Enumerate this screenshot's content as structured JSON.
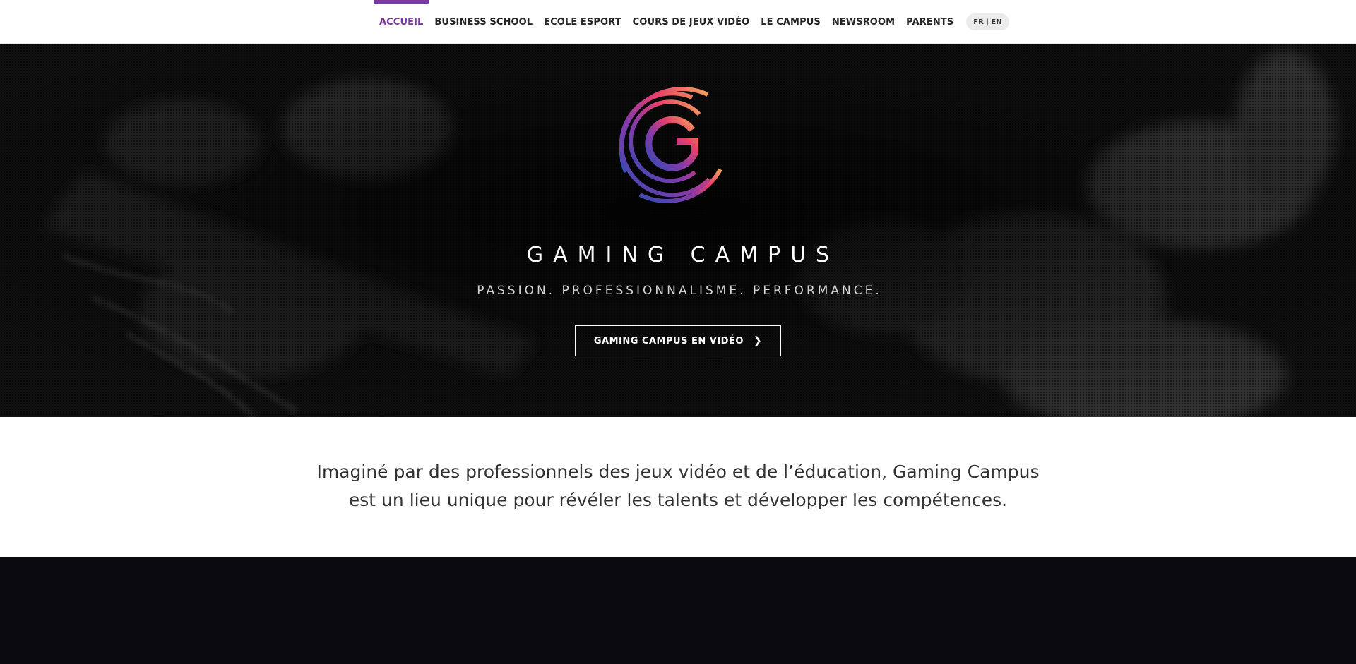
{
  "nav": {
    "items": [
      {
        "label": "ACCUEIL",
        "active": true
      },
      {
        "label": "BUSINESS SCHOOL",
        "active": false
      },
      {
        "label": "ECOLE ESPORT",
        "active": false
      },
      {
        "label": "COURS DE JEUX VIDÉO",
        "active": false
      },
      {
        "label": "LE CAMPUS",
        "active": false
      },
      {
        "label": "NEWSROOM",
        "active": false
      },
      {
        "label": "PARENTS",
        "active": false
      }
    ],
    "lang_switch": "FR | EN",
    "accent_color": "#7b3aa0"
  },
  "hero": {
    "logo_icon": "gaming-campus-g-logo",
    "logo_gradient": [
      "#2f4bb5",
      "#8a3aa8",
      "#e8406a",
      "#f3a35b"
    ],
    "title": "GAMING CAMPUS",
    "tagline": "PASSION. PROFESSIONNALISME. PERFORMANCE.",
    "button_label": "GAMING CAMPUS EN VIDÉO",
    "button_icon": "chevron-right-icon"
  },
  "intro": {
    "line1": "Imaginé par des professionnels des jeux vidéo et de l’éducation, Gaming Campus",
    "line2": "est un lieu unique pour révéler les talents et développer les compétences."
  }
}
